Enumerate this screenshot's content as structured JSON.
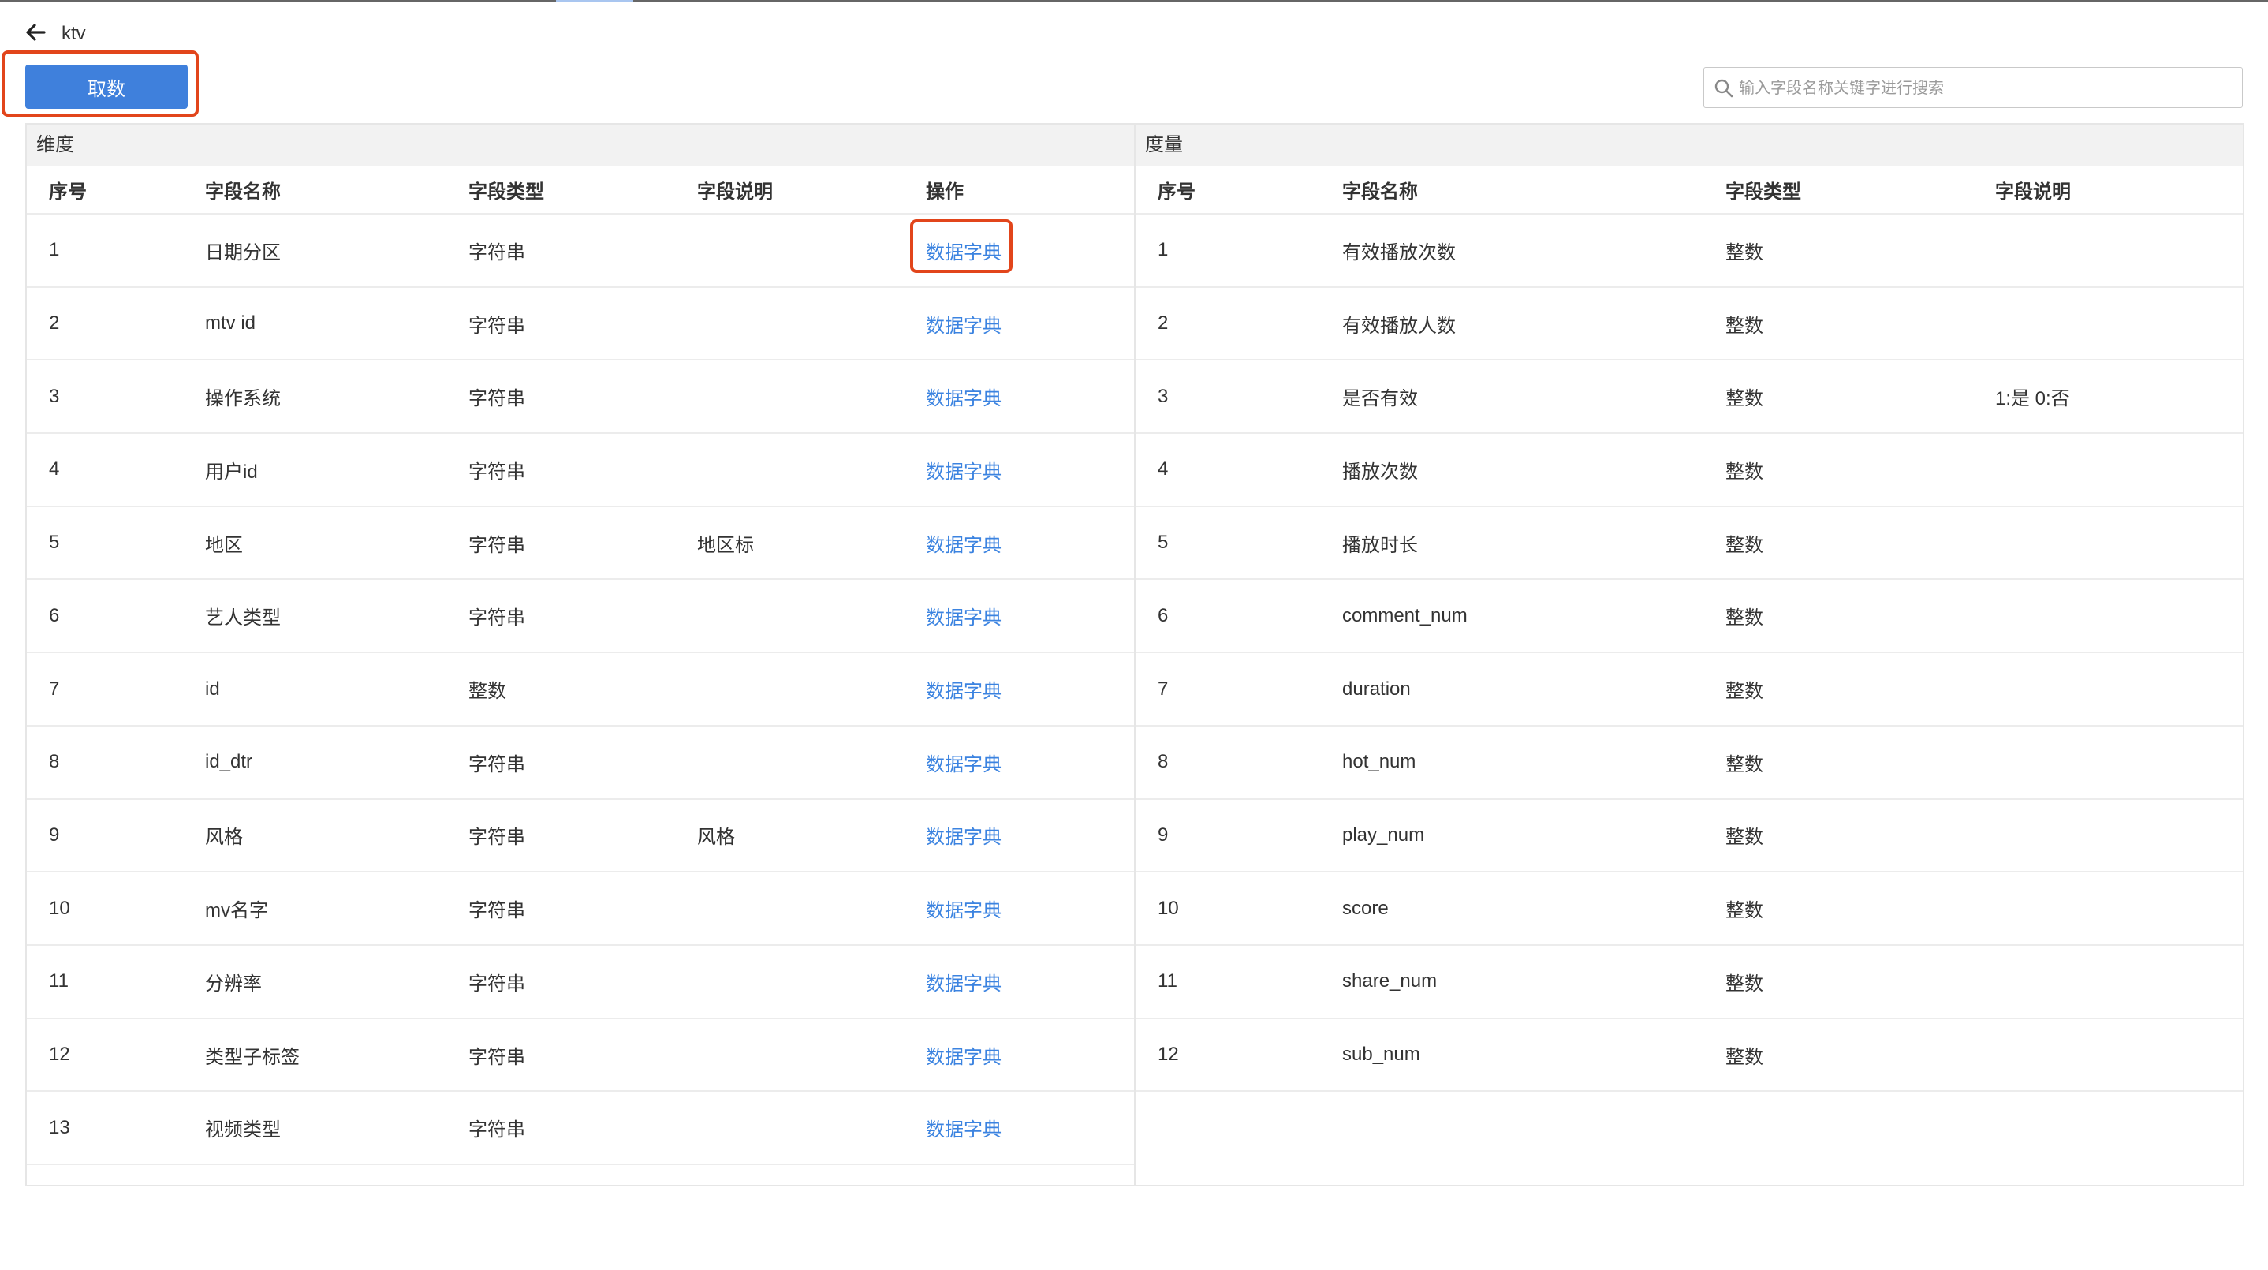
{
  "header": {
    "title": "ktv"
  },
  "toolbar": {
    "fetch_label": "取数"
  },
  "search": {
    "placeholder": "输入字段名称关键字进行搜索"
  },
  "dimensions": {
    "section_label": "维度",
    "columns": [
      "序号",
      "字段名称",
      "字段类型",
      "字段说明",
      "操作"
    ],
    "action_label": "数据字典",
    "rows": [
      {
        "no": "1",
        "name": "日期分区",
        "type": "字符串",
        "desc": ""
      },
      {
        "no": "2",
        "name": "mtv id",
        "type": "字符串",
        "desc": ""
      },
      {
        "no": "3",
        "name": "操作系统",
        "type": "字符串",
        "desc": ""
      },
      {
        "no": "4",
        "name": "用户id",
        "type": "字符串",
        "desc": ""
      },
      {
        "no": "5",
        "name": "地区",
        "type": "字符串",
        "desc": "地区标"
      },
      {
        "no": "6",
        "name": "艺人类型",
        "type": "字符串",
        "desc": ""
      },
      {
        "no": "7",
        "name": "id",
        "type": "整数",
        "desc": ""
      },
      {
        "no": "8",
        "name": "id_dtr",
        "type": "字符串",
        "desc": ""
      },
      {
        "no": "9",
        "name": "风格",
        "type": "字符串",
        "desc": "风格"
      },
      {
        "no": "10",
        "name": "mv名字",
        "type": "字符串",
        "desc": ""
      },
      {
        "no": "11",
        "name": "分辨率",
        "type": "字符串",
        "desc": ""
      },
      {
        "no": "12",
        "name": "类型子标签",
        "type": "字符串",
        "desc": ""
      },
      {
        "no": "13",
        "name": "视频类型",
        "type": "字符串",
        "desc": ""
      }
    ]
  },
  "measures": {
    "section_label": "度量",
    "columns": [
      "序号",
      "字段名称",
      "字段类型",
      "字段说明"
    ],
    "rows": [
      {
        "no": "1",
        "name": "有效播放次数",
        "type": "整数",
        "desc": ""
      },
      {
        "no": "2",
        "name": "有效播放人数",
        "type": "整数",
        "desc": ""
      },
      {
        "no": "3",
        "name": "是否有效",
        "type": "整数",
        "desc": "1:是 0:否"
      },
      {
        "no": "4",
        "name": "播放次数",
        "type": "整数",
        "desc": ""
      },
      {
        "no": "5",
        "name": "播放时长",
        "type": "整数",
        "desc": ""
      },
      {
        "no": "6",
        "name": "comment_num",
        "type": "整数",
        "desc": ""
      },
      {
        "no": "7",
        "name": "duration",
        "type": "整数",
        "desc": ""
      },
      {
        "no": "8",
        "name": "hot_num",
        "type": "整数",
        "desc": ""
      },
      {
        "no": "9",
        "name": "play_num",
        "type": "整数",
        "desc": ""
      },
      {
        "no": "10",
        "name": "score",
        "type": "整数",
        "desc": ""
      },
      {
        "no": "11",
        "name": "share_num",
        "type": "整数",
        "desc": ""
      },
      {
        "no": "12",
        "name": "sub_num",
        "type": "整数",
        "desc": ""
      }
    ]
  },
  "icons": {
    "back": "arrow-left-icon",
    "search": "search-icon"
  },
  "colors": {
    "primary": "#3f80dc",
    "link": "#3b83e0",
    "highlight": "#e2451b",
    "header_bg": "#f2f2f2"
  }
}
